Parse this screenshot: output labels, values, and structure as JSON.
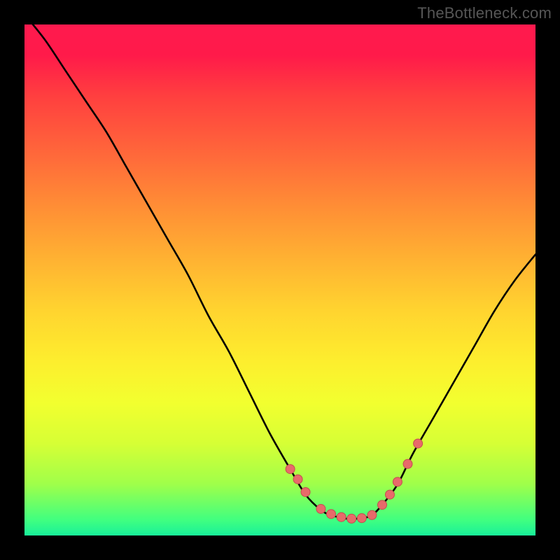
{
  "watermark": "TheBottleneck.com",
  "chart_data": {
    "type": "line",
    "title": "",
    "xlabel": "",
    "ylabel": "",
    "xlim": [
      0,
      100
    ],
    "ylim": [
      0,
      100
    ],
    "grid": false,
    "legend": false,
    "series": [
      {
        "name": "curve",
        "x": [
          0,
          4,
          8,
          12,
          16,
          20,
          24,
          28,
          32,
          36,
          40,
          44,
          48,
          52,
          55,
          58,
          60,
          63,
          66,
          68,
          70,
          73,
          76,
          80,
          84,
          88,
          92,
          96,
          100
        ],
        "y": [
          102,
          97,
          91,
          85,
          79,
          72,
          65,
          58,
          51,
          43,
          36,
          28,
          20,
          13,
          8,
          5,
          4,
          3.3,
          3.4,
          4,
          6,
          10,
          16,
          23,
          30,
          37,
          44,
          50,
          55
        ]
      }
    ],
    "markers": {
      "name": "dots",
      "x": [
        52,
        53.5,
        55,
        58,
        60,
        62,
        64,
        66,
        68,
        70,
        71.5,
        73,
        75,
        77
      ],
      "y": [
        13,
        11,
        8.5,
        5.2,
        4.2,
        3.6,
        3.3,
        3.4,
        4,
        6,
        8,
        10.5,
        14,
        18
      ]
    },
    "colors": {
      "curve": "#000000",
      "markers_fill": "#e86a6a",
      "markers_stroke": "#c34f4f"
    }
  }
}
